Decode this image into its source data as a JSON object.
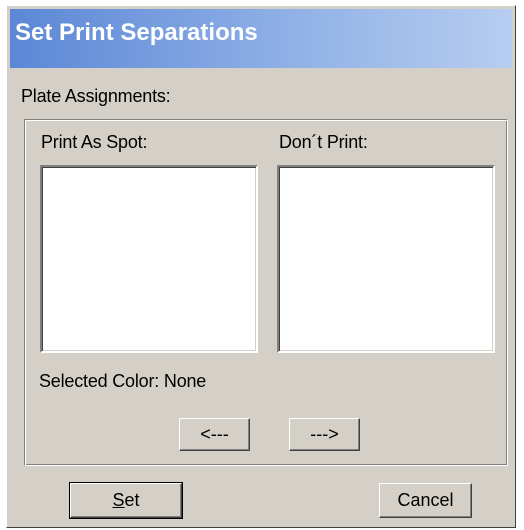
{
  "dialog": {
    "title": "Set Print Separations",
    "plate_assignments_label": "Plate Assignments:",
    "print_as_spot_label": "Print As Spot:",
    "dont_print_label": "Don´t Print:",
    "selected_color_label": "Selected Color:",
    "selected_color_value": "None",
    "move_left_label": "<---",
    "move_right_label": "--->",
    "set_mnemonic": "S",
    "set_rest": "et",
    "cancel_label": "Cancel",
    "print_as_spot_items": [],
    "dont_print_items": []
  },
  "colors": {
    "title_gradient_start": "#5b87d6",
    "title_gradient_end": "#b7cdf0",
    "dialog_face": "#d4d0c8"
  }
}
